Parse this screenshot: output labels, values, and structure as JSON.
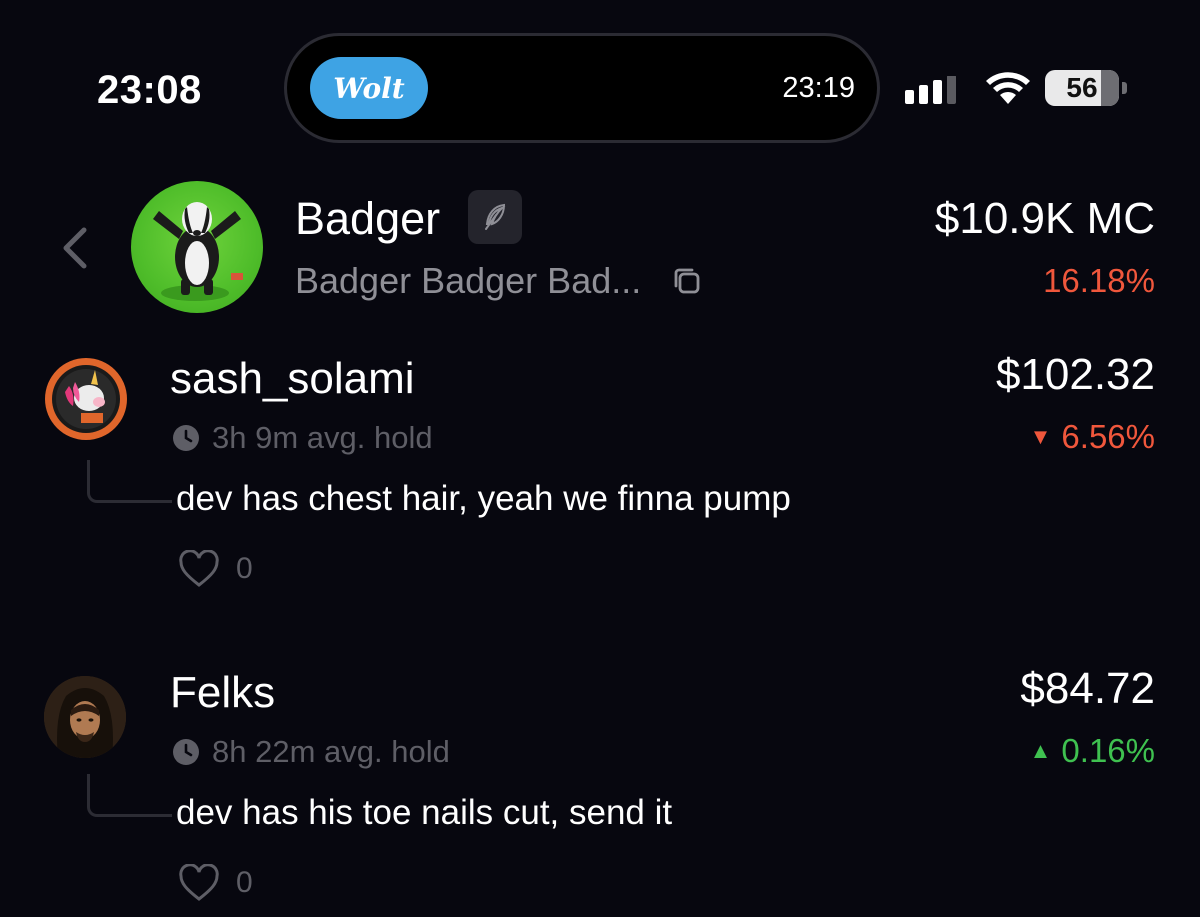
{
  "status_bar": {
    "time": "23:08",
    "live_activity": {
      "app_label": "Wolt",
      "time": "23:19"
    },
    "battery_level": "56",
    "icons": [
      "cellular-signal-icon",
      "wifi-icon",
      "battery-icon"
    ]
  },
  "token": {
    "name": "Badger",
    "subtitle": "Badger Badger Bad...",
    "market_cap": "$10.9K MC",
    "change": "16.18%",
    "change_color": "#f0573c",
    "icons": [
      "back-chevron-icon",
      "feather-icon",
      "copy-icon"
    ]
  },
  "comments": [
    {
      "username": "sash_solami",
      "avg_hold": "3h 9m avg. hold",
      "text": "dev has chest hair, yeah we finna pump",
      "likes": "0",
      "value": "$102.32",
      "change": "6.56%",
      "direction": "down"
    },
    {
      "username": "Felks",
      "avg_hold": "8h 22m avg. hold",
      "text": "dev has his toe nails cut, send it",
      "likes": "0",
      "value": "$84.72",
      "change": "0.16%",
      "direction": "up"
    }
  ],
  "colors": {
    "background": "#07070f",
    "negative": "#f0573c",
    "positive": "#3fc150",
    "muted_text": "#5e5e66",
    "wolt_blue": "#3ea3e4"
  }
}
